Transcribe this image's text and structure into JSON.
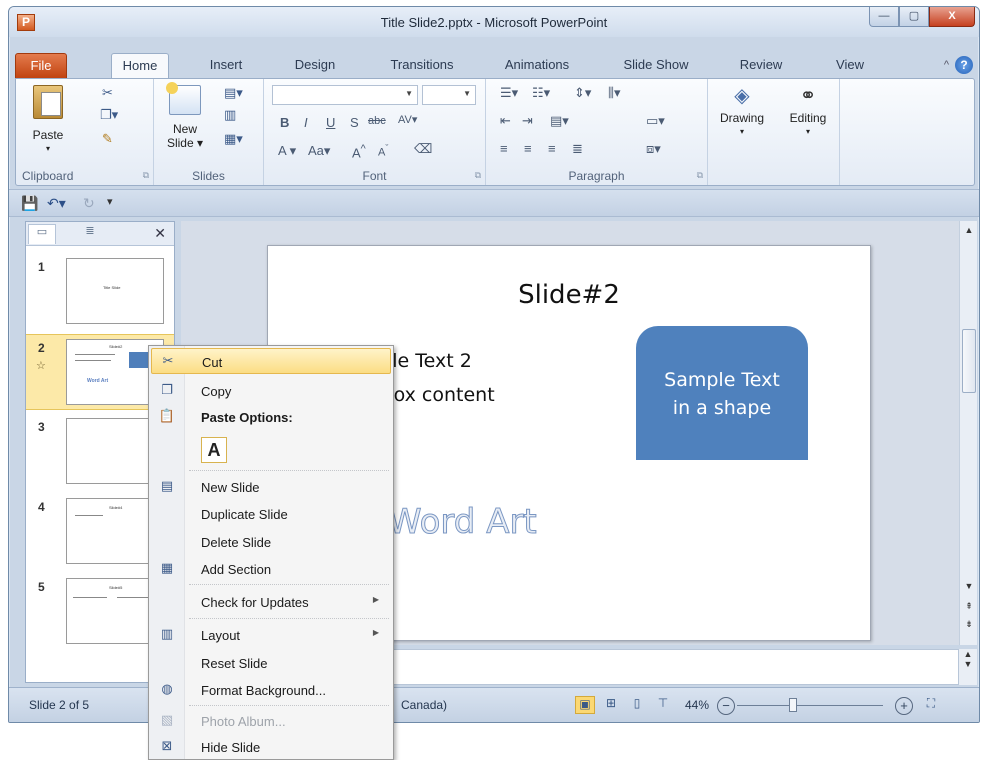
{
  "window": {
    "title": "Title Slide2.pptx - Microsoft PowerPoint",
    "app_icon_letter": "P",
    "controls": [
      "—",
      "▢",
      "X"
    ]
  },
  "ribbon_tabs": [
    "File",
    "Home",
    "Insert",
    "Design",
    "Transitions",
    "Animations",
    "Slide Show",
    "Review",
    "View"
  ],
  "ribbon": {
    "groups": {
      "clipboard": {
        "label": "Clipboard",
        "paste": "Paste"
      },
      "slides": {
        "label": "Slides",
        "new_slide_line1": "New",
        "new_slide_line2": "Slide ▾"
      },
      "font": {
        "label": "Font"
      },
      "paragraph": {
        "label": "Paragraph"
      },
      "drawing": {
        "label": "Drawing"
      },
      "editing": {
        "label": "Editing"
      }
    }
  },
  "slide_pane": {
    "thumbnails": [
      {
        "num": "1",
        "text": "Title Slide"
      },
      {
        "num": "2",
        "text": "Slide#2"
      },
      {
        "num": "3",
        "text": ""
      },
      {
        "num": "4",
        "text": "Slide#4"
      },
      {
        "num": "5",
        "text": "Slide#5"
      }
    ]
  },
  "slide": {
    "title": "Slide#2",
    "line1": "Sample Text 2",
    "line2": "text box content",
    "shape_text_line1": "Sample Text",
    "shape_text_line2": "in a shape",
    "wordart": "Word Art"
  },
  "statusbar": {
    "slide_info": "Slide 2 of 5",
    "language": "Canada)",
    "zoom": "44%"
  },
  "context_menu": {
    "cut": "Cut",
    "copy": "Copy",
    "paste_options": "Paste Options:",
    "paste_keep_text": "A",
    "new_slide": "New Slide",
    "duplicate_slide": "Duplicate Slide",
    "delete_slide": "Delete Slide",
    "add_section": "Add Section",
    "check_updates": "Check for Updates",
    "layout": "Layout",
    "reset_slide": "Reset Slide",
    "format_background": "Format Background...",
    "photo_album": "Photo Album...",
    "hide_slide": "Hide Slide"
  }
}
